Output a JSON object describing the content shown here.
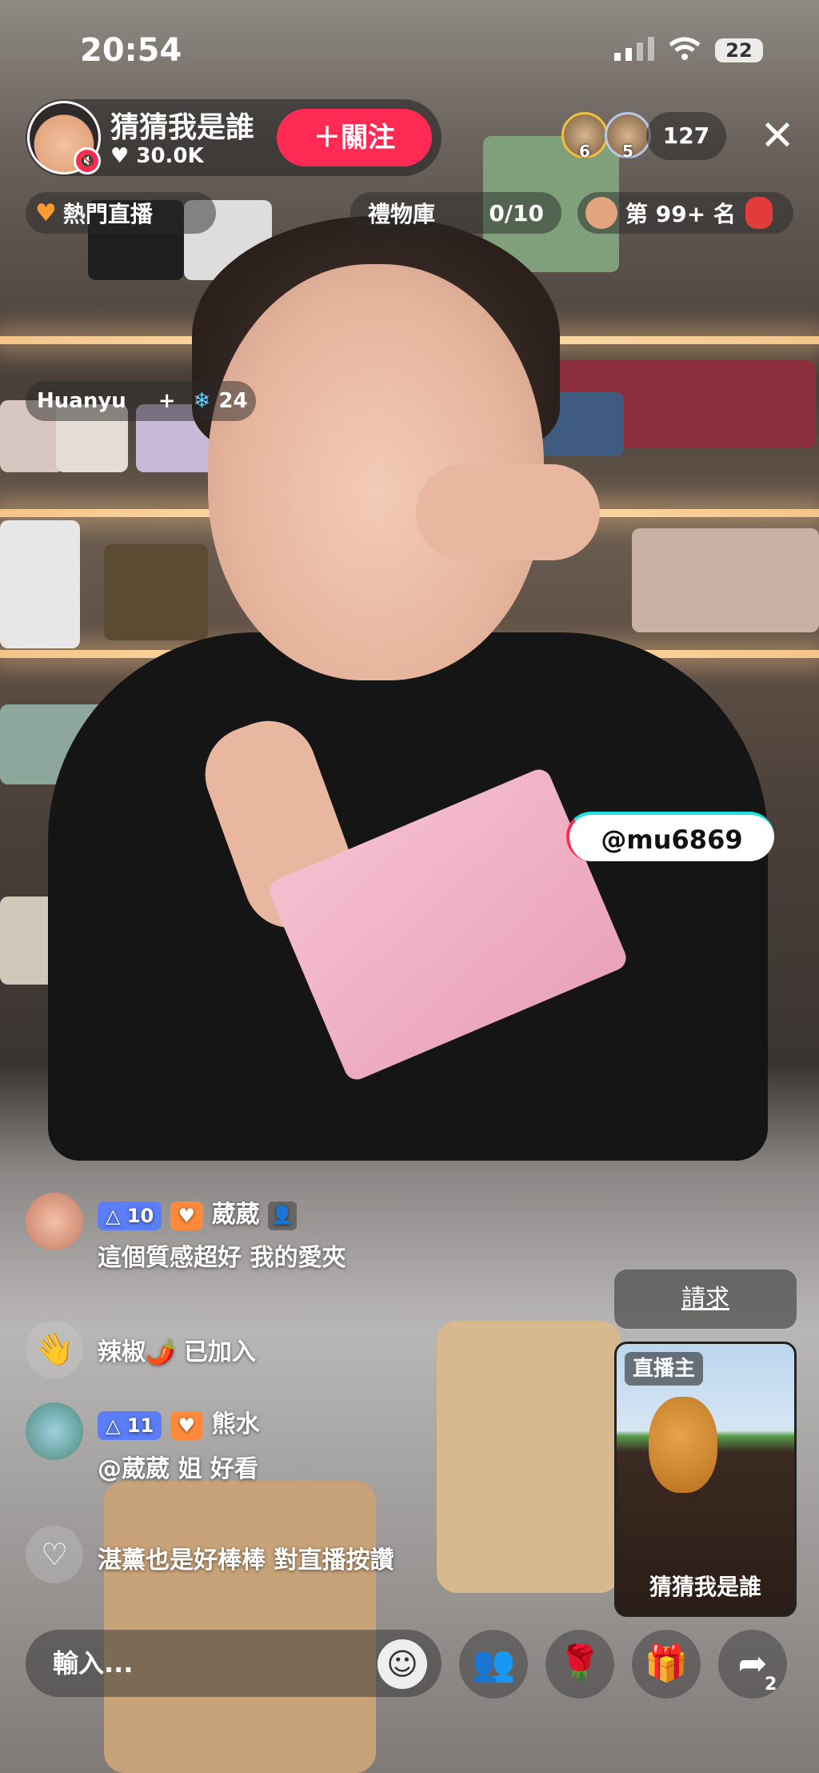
{
  "status_bar": {
    "time": "20:54",
    "battery": "22"
  },
  "host": {
    "name": "猜猜我是誰",
    "likes": "30.0K",
    "follow_label": "＋關注"
  },
  "viewers": {
    "top": [
      {
        "rank": "6"
      },
      {
        "rank": "5"
      }
    ],
    "count": "127"
  },
  "tags": {
    "hot_live": "熱門直播",
    "gift_library": "禮物庫",
    "gift_progress": "0/10",
    "rank": "第 99+ 名"
  },
  "guest": {
    "name": "Huanyu",
    "add": "+",
    "score": "24"
  },
  "mention": "@mu6869",
  "chat": [
    {
      "level": "10",
      "name": "葳葳",
      "text": "這個質感超好 我的愛夾"
    },
    {
      "name": "辣椒🌶️",
      "text": "已加入"
    },
    {
      "level": "11",
      "name": "熊水",
      "text": "@葳葳 姐 好看"
    },
    {
      "text": "湛薰也是好棒棒 對直播按讚"
    }
  ],
  "request_label": "請求",
  "pip": {
    "label": "直播主",
    "name": "猜猜我是誰"
  },
  "input_placeholder": "輸入...",
  "share_count": "2",
  "icons": {
    "heart": "heart-icon",
    "close": "close-icon",
    "wave": "wave-icon",
    "emoji": "emoji-icon",
    "guests": "guests-icon",
    "rose": "rose-icon",
    "gift": "gift-icon",
    "share": "share-icon"
  }
}
